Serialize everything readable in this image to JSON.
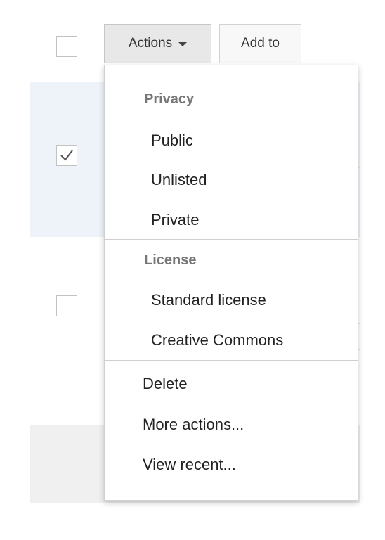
{
  "toolbar": {
    "actions_label": "Actions",
    "add_to_label": "Add to"
  },
  "menu": {
    "privacy_heading": "Privacy",
    "privacy_items": [
      "Public",
      "Unlisted",
      "Private"
    ],
    "license_heading": "License",
    "license_items": [
      "Standard license",
      "Creative Commons"
    ],
    "delete_label": "Delete",
    "more_actions_label": "More actions...",
    "view_recent_label": "View recent..."
  },
  "rows": [
    {
      "checked": true
    },
    {
      "checked": false
    }
  ]
}
